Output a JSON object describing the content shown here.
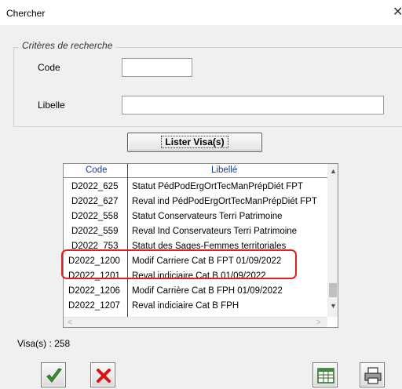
{
  "window": {
    "title": "Chercher",
    "close_glyph": "✕"
  },
  "criteria": {
    "group_title": "Critères de recherche",
    "code_label": "Code",
    "code_value": "",
    "libelle_label": "Libelle",
    "libelle_value": ""
  },
  "lister_button": {
    "label": "Lister Visa(s)"
  },
  "grid": {
    "columns": [
      "Code",
      "Libellé"
    ],
    "rows": [
      {
        "code": "D2022_625",
        "libelle": "Statut PédPodErgOrtTecManPrépDiét FPT"
      },
      {
        "code": "D2022_627",
        "libelle": "Reval ind PédPodErgOrtTecManPrépDiét FPT"
      },
      {
        "code": "D2022_558",
        "libelle": "Statut Conservateurs Terri Patrimoine"
      },
      {
        "code": "D2022_559",
        "libelle": "Reval Ind Conservateurs Terri Patrimoine"
      },
      {
        "code": "D2022_753",
        "libelle": "Statut des Sages-Femmes territoriales"
      },
      {
        "code": "D2022_1200",
        "libelle": "Modif Carriere Cat B FPT 01/09/2022"
      },
      {
        "code": "D2022_1201",
        "libelle": "Reval indiciaire Cat B 01/09/2022"
      },
      {
        "code": "D2022_1206",
        "libelle": "Modif Carrière Cat B FPH 01/09/2022"
      },
      {
        "code": "D2022_1207",
        "libelle": "Reval indiciaire Cat B FPH"
      }
    ]
  },
  "footer": {
    "count_text": "Visa(s) : 258"
  },
  "icons": {
    "ok": "checkmark-icon",
    "cancel": "red-x-icon",
    "export": "spreadsheet-icon",
    "print": "printer-icon"
  },
  "colors": {
    "highlight": "#e02020",
    "header_text": "#1a3c8c"
  }
}
